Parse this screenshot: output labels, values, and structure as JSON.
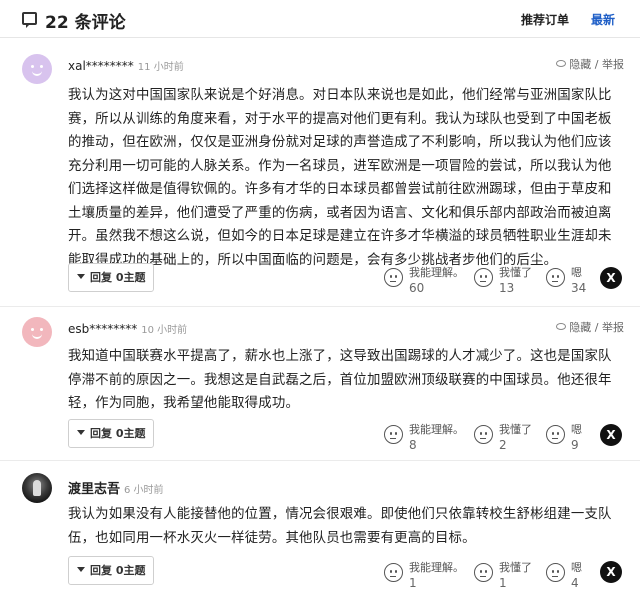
{
  "header": {
    "icon": "comment-icon",
    "title": "22 条评论",
    "sort_recommended": "推荐订单",
    "sort_newest": "最新"
  },
  "comments": [
    {
      "username": "xal********",
      "time": "11 小时前",
      "report": "隐藏 / 举报",
      "text": "我认为这对中国国家队来说是个好消息。对日本队来说也是如此，他们经常与亚洲国家队比赛，所以从训练的角度来看，对于水平的提高对他们更有利。我认为球队也受到了中国老板的推动，但在欧洲，仅仅是亚洲身份就对足球的声誉造成了不利影响，所以我认为他们应该充分利用一切可能的人脉关系。作为一名球员，进军欧洲是一项冒险的尝试，所以我认为他们选择这样做是值得钦佩的。许多有才华的日本球员都曾尝试前往欧洲踢球，但由于草皮和土壤质量的差异，他们遭受了严重的伤病，或者因为语言、文化和俱乐部内部政治而被迫离开。虽然我不想这么说，但如今的日本足球是建立在许多才华横溢的球员牺牲职业生涯却未能取得成功的基础上的，所以中国面临的问题是，会有多少挑战者步他们的后尘。",
      "reply_label": "回复 0主题",
      "reactions": [
        {
          "label": "我能理解。",
          "count": "60",
          "icon": "face-icon"
        },
        {
          "label": "我懂了",
          "count": "13",
          "icon": "face-icon"
        },
        {
          "label": "嗯",
          "count": "34",
          "icon": "face-icon"
        }
      ],
      "share_icon": "X",
      "avatar_color": "#d8c3ee"
    },
    {
      "username": "esb********",
      "time": "10 小时前",
      "report": "隐藏 / 举报",
      "text": "我知道中国联赛水平提高了，薪水也上涨了，这导致出国踢球的人才减少了。这也是国家队停滞不前的原因之一。我想这是自武磊之后，首位加盟欧洲顶级联赛的中国球员。他还很年轻，作为同胞，我希望他能取得成功。",
      "reply_label": "回复 0主题",
      "reactions": [
        {
          "label": "我能理解。",
          "count": "8",
          "icon": "face-icon"
        },
        {
          "label": "我懂了",
          "count": "2",
          "icon": "face-icon"
        },
        {
          "label": "嗯",
          "count": "9",
          "icon": "face-icon"
        }
      ],
      "share_icon": "X",
      "avatar_color": "#f2b7bd"
    },
    {
      "username": "渡里志吾",
      "time": "6 小时前",
      "text": "我认为如果没有人能接替他的位置，情况会很艰难。即使他们只依靠转校生舒彬组建一支队伍，也如同用一杯水灭火一样徒劳。其他队员也需要有更高的目标。",
      "reply_label": "回复 0主题",
      "reactions": [
        {
          "label": "我能理解。",
          "count": "1",
          "icon": "face-icon"
        },
        {
          "label": "我懂了",
          "count": "1",
          "icon": "face-icon"
        },
        {
          "label": "嗯",
          "count": "4",
          "icon": "face-icon"
        }
      ],
      "share_icon": "X"
    }
  ]
}
